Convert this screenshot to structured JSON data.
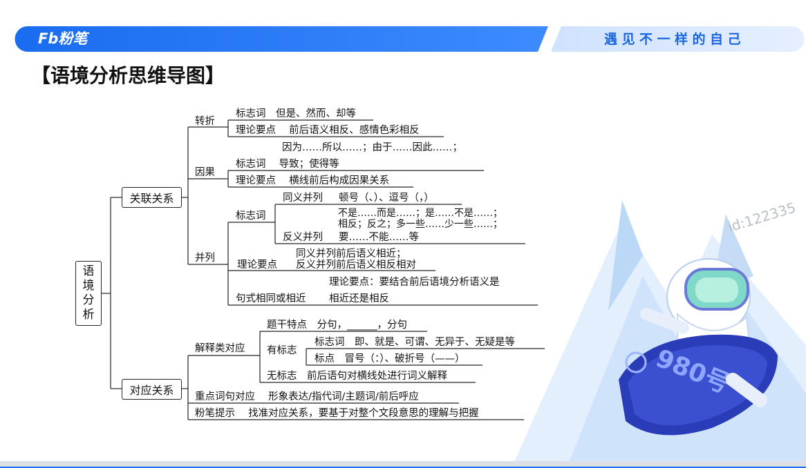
{
  "header": {
    "logo_mark": "Fb",
    "logo_text": "粉笔",
    "slogan": "遇见不一样的自己"
  },
  "page_title": "【语境分析思维导图】",
  "watermark": "id:122335",
  "mascot": {
    "board_text": "980号"
  },
  "mindmap": {
    "root": [
      "语",
      "境",
      "分",
      "析"
    ],
    "b1": {
      "label": "关联关系",
      "zhuanzhe": {
        "label": "转折",
        "l1": "标志词　但是、然而、却等",
        "l2": "理论要点　 前后语义相反、感情色彩相反"
      },
      "yinguo": {
        "label": "因果",
        "pre": "因为……所以……；由于……因此……；",
        "l1": "标志词　 导致；使得等",
        "l2": "理论要点　 横线前后构成因果关系"
      },
      "binglie": {
        "label": "并列",
        "biaozhi": "标志词",
        "tongyi_label": "同义并列",
        "tongyi_text": "顿号（、）、逗号（，）",
        "fanyi_pre1": "不是……而是……；是……不是……；",
        "fanyi_pre2": "相反；反之；多一些……少一些……；",
        "fanyi_label": "反义并列",
        "fanyi_text": "要……不能……等",
        "lilun_label": "理论要点",
        "lilun_1": "同义并列前后语义相近；",
        "lilun_2": "反义并列前后语义相反相对",
        "jushi_label": "句式相同或相近",
        "jushi_pre": "理论要点：要结合前后语境分析语义是",
        "jushi_text": "相近还是相反"
      }
    },
    "b2": {
      "label": "对应关系",
      "jieshi": {
        "label": "解释类对应",
        "tigan": "题干特点　分句，______，分句",
        "youbiaozhi": "有标志",
        "biaozhi_ci": "标志词　即、就是、可谓、无异于、无疑是等",
        "biaodian": "标点　冒号（：）、破折号（——）",
        "wubiaozhi": "无标志　前后语句对横线处进行词义解释"
      },
      "zhongdian": "重点词句对应　 形象表达/指代词/主题词/前后呼应",
      "tishi": "粉笔提示　 找准对应关系，要基于对整个文段意思的理解与把握"
    }
  }
}
